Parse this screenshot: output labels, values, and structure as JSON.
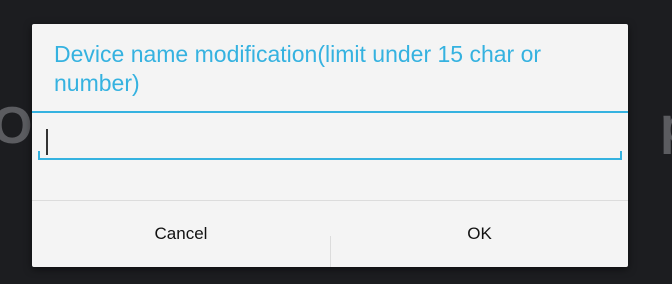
{
  "dialog": {
    "title": "Device name modification(limit under 15 char or number)",
    "input": {
      "value": ""
    },
    "buttons": {
      "cancel_label": "Cancel",
      "ok_label": "OK"
    }
  },
  "colors": {
    "accent": "#35b2e0",
    "dialog_background": "#f4f4f4",
    "backdrop": "#1c1d20"
  }
}
